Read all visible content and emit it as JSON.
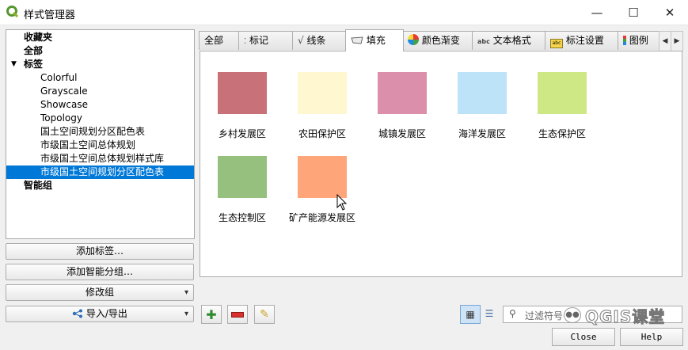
{
  "window": {
    "title": "样式管理器",
    "minimize": "—",
    "maximize": "☐",
    "close": "✕"
  },
  "tree": {
    "favorites": "收藏夹",
    "all": "全部",
    "tags": "标签",
    "tag_items": [
      "Colorful",
      "Grayscale",
      "Showcase",
      "Topology",
      "国土空间规划分区配色表",
      "市级国土空间总体规划",
      "市级国土空间总体规划样式库",
      "市级国土空间规划分区配色表"
    ],
    "smart_groups": "智能组",
    "selected_index": 7
  },
  "left_buttons": {
    "add_tag": "添加标签…",
    "add_smart_group": "添加智能分组…",
    "modify_group": "修改组",
    "import_export": "导入/导出"
  },
  "tabs": [
    "全部",
    "标记",
    "线条",
    "填充",
    "颜色渐变",
    "文本格式",
    "标注设置",
    "图例"
  ],
  "active_tab": "填充",
  "symbols": [
    {
      "name": "乡村发展区",
      "color": "#c87178"
    },
    {
      "name": "农田保护区",
      "color": "#fff7d0"
    },
    {
      "name": "城镇发展区",
      "color": "#dc8fab"
    },
    {
      "name": "海洋发展区",
      "color": "#bde3f8"
    },
    {
      "name": "生态保护区",
      "color": "#cfe886"
    },
    {
      "name": "生态控制区",
      "color": "#95c07d"
    },
    {
      "name": "矿产能源发展区",
      "color": "#ffa57a"
    }
  ],
  "filter": {
    "placeholder": "过滤符号"
  },
  "watermark": "QGIS课堂",
  "buttons": {
    "close": "Close",
    "help": "Help"
  }
}
